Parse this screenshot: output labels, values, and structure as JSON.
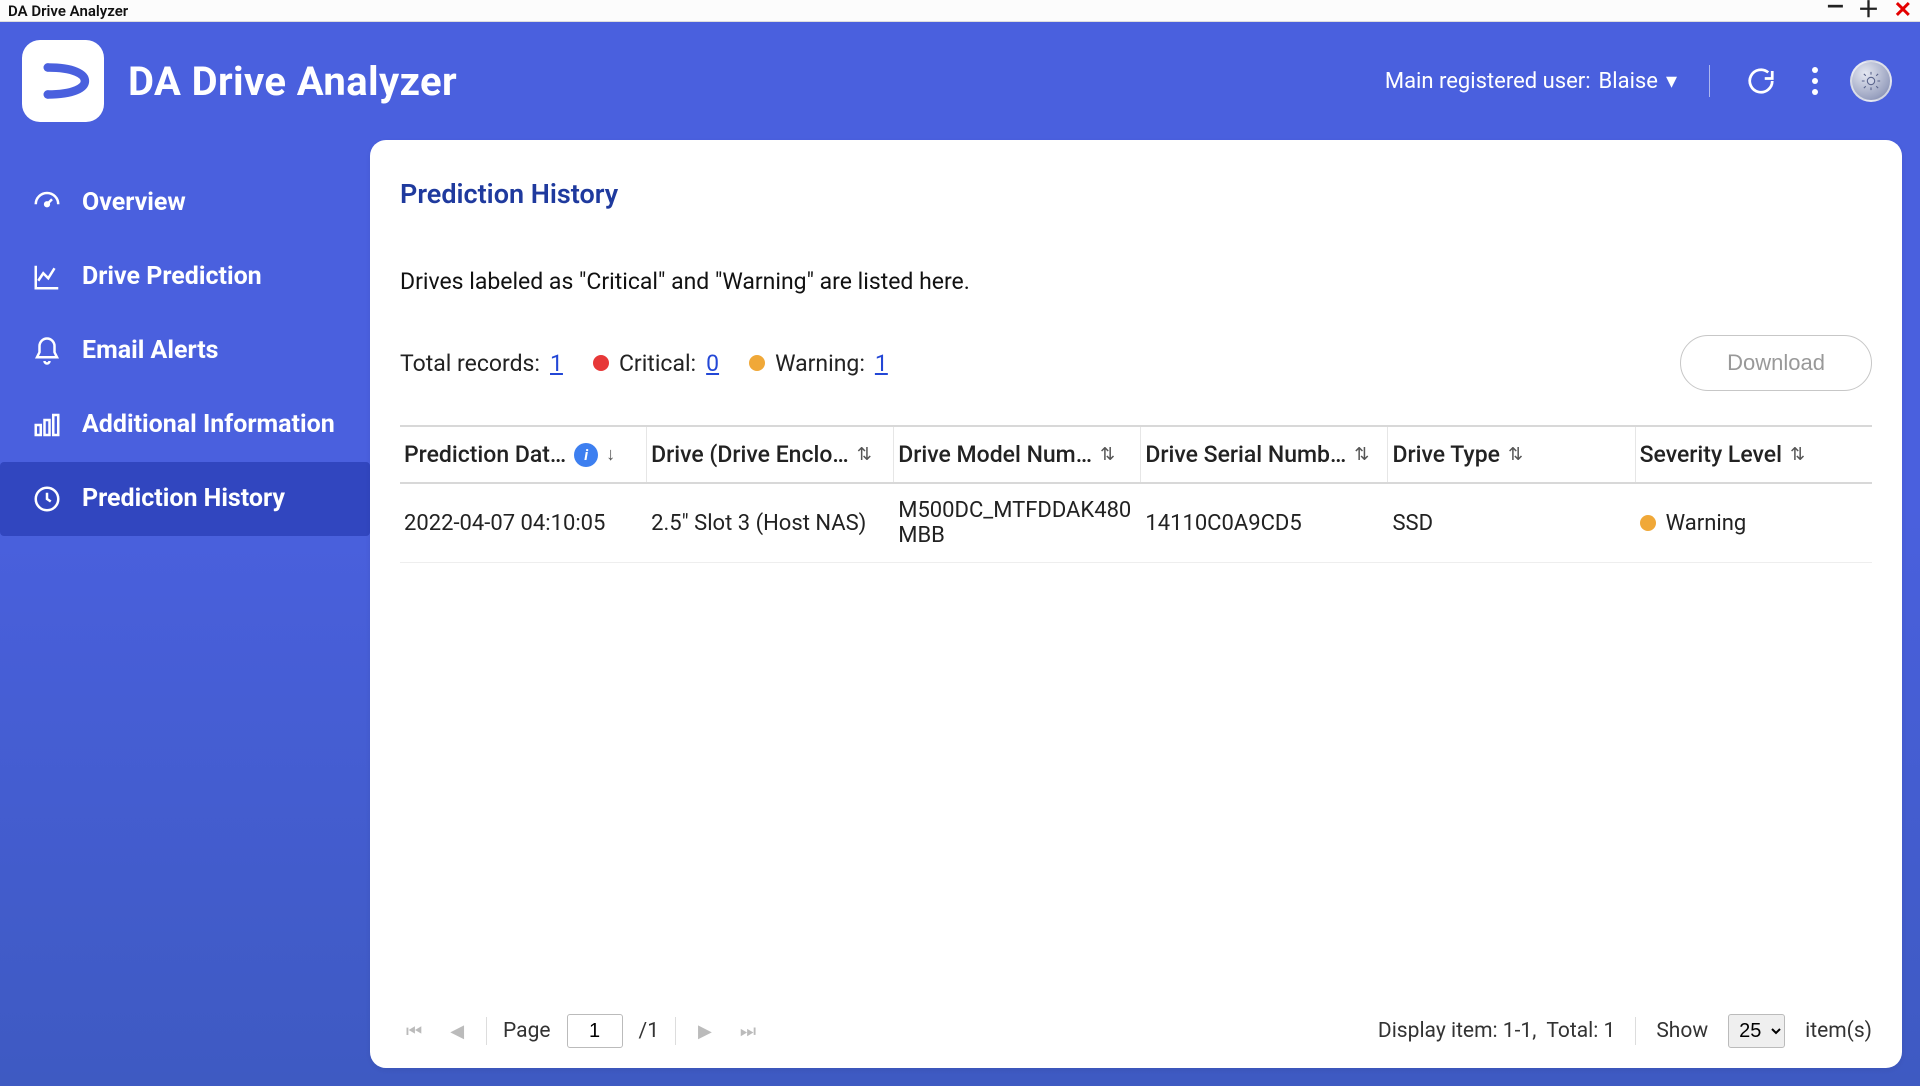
{
  "window": {
    "title": "DA Drive Analyzer"
  },
  "app": {
    "title": "DA Drive Analyzer"
  },
  "header": {
    "user_label_prefix": "Main registered user:",
    "user_name": "Blaise"
  },
  "sidebar": {
    "items": [
      {
        "label": "Overview"
      },
      {
        "label": "Drive Prediction"
      },
      {
        "label": "Email Alerts"
      },
      {
        "label": "Additional Information"
      },
      {
        "label": "Prediction History"
      }
    ]
  },
  "panel": {
    "title": "Prediction History",
    "description": "Drives labeled as \"Critical\" and \"Warning\" are listed here.",
    "summary": {
      "total_label": "Total records:",
      "total_value": "1",
      "critical_label": "Critical:",
      "critical_value": "0",
      "warning_label": "Warning:",
      "warning_value": "1"
    },
    "download_label": "Download",
    "columns": {
      "date": "Prediction Dat…",
      "drive": "Drive (Drive Enclo…",
      "model": "Drive Model Num…",
      "serial": "Drive Serial Numb…",
      "type": "Drive Type",
      "severity": "Severity Level"
    },
    "rows": [
      {
        "date": "2022-04-07 04:10:05",
        "drive": "2.5\" Slot 3 (Host NAS)",
        "model": "M500DC_MTFDDAK480MBB",
        "serial": "14110C0A9CD5",
        "type": "SSD",
        "severity": "Warning",
        "severity_color": "#f0a838"
      }
    ]
  },
  "footer": {
    "page_label": "Page",
    "page_value": "1",
    "page_total": "/1",
    "display_label": "Display item: 1-1,  Total: 1",
    "show_label": "Show",
    "show_value": "25",
    "items_label": "item(s)"
  }
}
